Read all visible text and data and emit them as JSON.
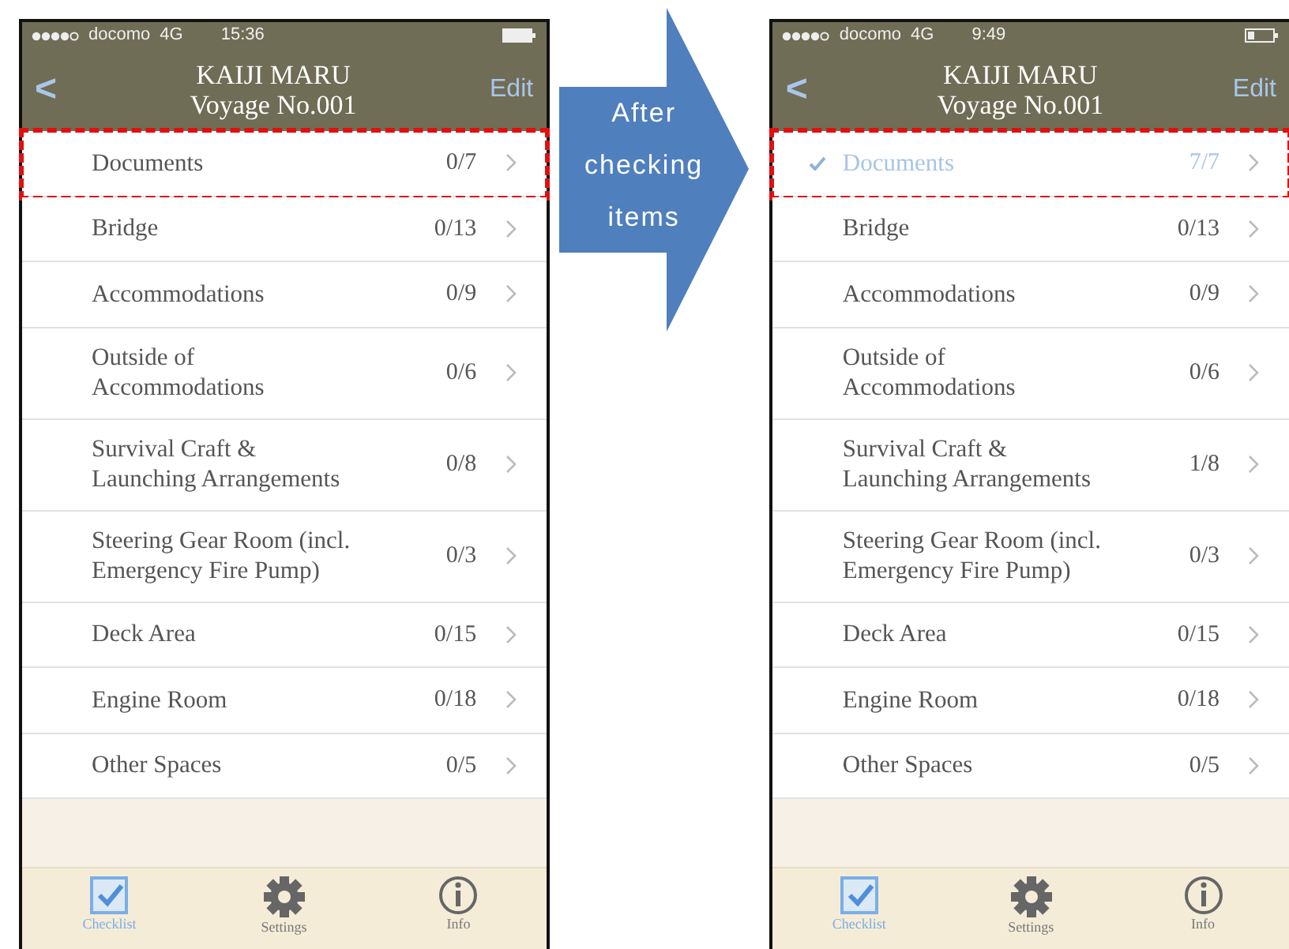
{
  "phones": [
    {
      "status_bar": {
        "carrier": "docomo",
        "network": "4G",
        "time": "15:36"
      },
      "nav": {
        "back": "<",
        "title": "KAIJI MARU",
        "subtitle": "Voyage No.001",
        "edit": "Edit"
      },
      "items": [
        {
          "label": "Documents",
          "count": "0/7",
          "checked": false,
          "highlighted": true
        },
        {
          "label": "Bridge",
          "count": "0/13",
          "checked": false,
          "highlighted": false
        },
        {
          "label": "Accommodations",
          "count": "0/9",
          "checked": false,
          "highlighted": false
        },
        {
          "label": "Outside of Accommodations",
          "count": "0/6",
          "checked": false,
          "highlighted": false
        },
        {
          "label": "Survival Craft & Launching Arrangements",
          "count": "0/8",
          "checked": false,
          "highlighted": false
        },
        {
          "label": "Steering Gear Room (incl. Emergency Fire Pump)",
          "count": "0/3",
          "checked": false,
          "highlighted": false
        },
        {
          "label": "Deck Area",
          "count": "0/15",
          "checked": false,
          "highlighted": false
        },
        {
          "label": "Engine Room",
          "count": "0/18",
          "checked": false,
          "highlighted": false
        },
        {
          "label": "Other Spaces",
          "count": "0/5",
          "checked": false,
          "highlighted": false
        }
      ],
      "tabs": [
        {
          "label": "Checklist",
          "selected": true
        },
        {
          "label": "Settings",
          "selected": false
        },
        {
          "label": "Info",
          "selected": false
        }
      ]
    },
    {
      "status_bar": {
        "carrier": "docomo",
        "network": "4G",
        "time": "9:49"
      },
      "nav": {
        "back": "<",
        "title": "KAIJI MARU",
        "subtitle": "Voyage No.001",
        "edit": "Edit"
      },
      "items": [
        {
          "label": "Documents",
          "count": "7/7",
          "checked": true,
          "highlighted": true
        },
        {
          "label": "Bridge",
          "count": "0/13",
          "checked": false,
          "highlighted": false
        },
        {
          "label": "Accommodations",
          "count": "0/9",
          "checked": false,
          "highlighted": false
        },
        {
          "label": "Outside of Accommodations",
          "count": "0/6",
          "checked": false,
          "highlighted": false
        },
        {
          "label": "Survival Craft & Launching Arrangements",
          "count": "1/8",
          "checked": false,
          "highlighted": false
        },
        {
          "label": "Steering Gear Room (incl. Emergency Fire Pump)",
          "count": "0/3",
          "checked": false,
          "highlighted": false
        },
        {
          "label": "Deck Area",
          "count": "0/15",
          "checked": false,
          "highlighted": false
        },
        {
          "label": "Engine Room",
          "count": "0/18",
          "checked": false,
          "highlighted": false
        },
        {
          "label": "Other Spaces",
          "count": "0/5",
          "checked": false,
          "highlighted": false
        }
      ],
      "tabs": [
        {
          "label": "Checklist",
          "selected": true
        },
        {
          "label": "Settings",
          "selected": false
        },
        {
          "label": "Info",
          "selected": false
        }
      ]
    }
  ],
  "arrow": {
    "text": "After checking items"
  }
}
